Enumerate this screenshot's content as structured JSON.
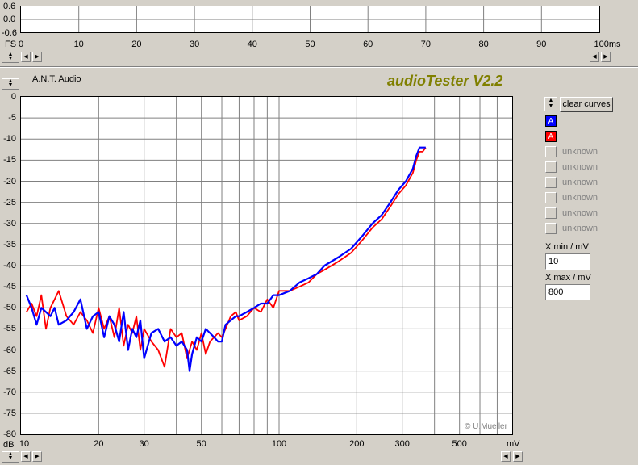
{
  "app_title": "audioTester V2.2",
  "device_name": "A.N.T. Audio",
  "scope": {
    "y_ticks": [
      "0.6",
      "0.0",
      "-0.6"
    ],
    "unit_label": "FS",
    "x_ticks": [
      "0",
      "10",
      "20",
      "30",
      "40",
      "50",
      "60",
      "70",
      "80",
      "90",
      "100ms"
    ]
  },
  "clear_curves_label": "clear curves",
  "legend": [
    {
      "letter": "A",
      "color": "#0000ff",
      "label": ""
    },
    {
      "letter": "A",
      "color": "#ff0000",
      "label": ""
    },
    {
      "letter": "",
      "color": "",
      "label": "unknown"
    },
    {
      "letter": "",
      "color": "",
      "label": "unknown"
    },
    {
      "letter": "",
      "color": "",
      "label": "unknown"
    },
    {
      "letter": "",
      "color": "",
      "label": "unknown"
    },
    {
      "letter": "",
      "color": "",
      "label": "unknown"
    },
    {
      "letter": "",
      "color": "",
      "label": "unknown"
    }
  ],
  "xmin": {
    "label": "X min / mV",
    "value": "10"
  },
  "xmax": {
    "label": "X max / mV",
    "value": "800"
  },
  "copyright": "© U.Mueller",
  "chart_data": {
    "type": "line",
    "x_scale": "log",
    "xlim": [
      10,
      800
    ],
    "ylim": [
      -80,
      0
    ],
    "grid": true,
    "xlabel": "mV",
    "ylabel": "dB",
    "x_tick_labels": [
      "10",
      "20",
      "30",
      "50",
      "100",
      "200",
      "300",
      "500"
    ],
    "y_tick_labels": [
      "0",
      "-5",
      "-10",
      "-15",
      "-20",
      "-25",
      "-30",
      "-35",
      "-40",
      "-45",
      "-50",
      "-55",
      "-60",
      "-65",
      "-70",
      "-75",
      "-80"
    ],
    "series": [
      {
        "color": "#0000ff",
        "x": [
          10.5,
          11,
          11.5,
          12,
          12.5,
          13,
          13.5,
          14,
          15,
          16,
          17,
          18,
          19,
          20,
          21,
          22,
          23,
          24,
          25,
          26,
          27,
          28,
          29,
          30,
          32,
          34,
          36,
          38,
          40,
          42,
          44,
          45,
          46,
          48,
          50,
          52,
          54,
          56,
          58,
          60,
          62,
          65,
          68,
          70,
          75,
          80,
          85,
          90,
          95,
          100,
          110,
          120,
          130,
          140,
          150,
          170,
          190,
          210,
          230,
          250,
          270,
          290,
          310,
          330,
          340,
          350,
          360,
          370
        ],
        "y": [
          -47,
          -50,
          -54,
          -50,
          -51,
          -52,
          -50,
          -54,
          -53,
          -51,
          -48,
          -55,
          -52,
          -51,
          -57,
          -52,
          -54,
          -58,
          -51,
          -60,
          -55,
          -57,
          -53,
          -62,
          -56,
          -55,
          -58,
          -57,
          -59,
          -58,
          -60,
          -65,
          -61,
          -57,
          -58,
          -55,
          -56,
          -57,
          -58,
          -58,
          -54,
          -53,
          -52,
          -52,
          -51,
          -50,
          -49,
          -49,
          -47,
          -47,
          -46,
          -44,
          -43,
          -42,
          -40,
          -38,
          -36,
          -33,
          -30,
          -28,
          -25,
          -22,
          -20,
          -17,
          -14,
          -12,
          -12,
          -12
        ]
      },
      {
        "color": "#ff0000",
        "x": [
          10.5,
          11,
          11.5,
          12,
          12.5,
          13,
          13.5,
          14,
          15,
          16,
          17,
          18,
          19,
          20,
          21,
          22,
          23,
          24,
          25,
          26,
          27,
          28,
          29,
          30,
          32,
          34,
          36,
          38,
          40,
          42,
          44,
          45,
          46,
          48,
          50,
          52,
          54,
          56,
          58,
          60,
          62,
          65,
          68,
          70,
          75,
          80,
          85,
          90,
          95,
          100,
          110,
          120,
          130,
          140,
          150,
          170,
          190,
          210,
          230,
          250,
          270,
          290,
          310,
          330,
          340,
          350,
          360,
          370
        ],
        "y": [
          -51,
          -49,
          -52,
          -47,
          -55,
          -50,
          -48,
          -46,
          -52,
          -54,
          -51,
          -53,
          -56,
          -50,
          -55,
          -52,
          -57,
          -50,
          -59,
          -54,
          -56,
          -52,
          -60,
          -55,
          -58,
          -60,
          -64,
          -55,
          -57,
          -56,
          -62,
          -60,
          -58,
          -60,
          -56,
          -61,
          -58,
          -57,
          -56,
          -57,
          -55,
          -52,
          -51,
          -53,
          -52,
          -50,
          -51,
          -48,
          -50,
          -46,
          -46,
          -45,
          -44,
          -42,
          -41,
          -39,
          -37,
          -34,
          -31,
          -29,
          -26,
          -23,
          -21,
          -18,
          -15,
          -13,
          -13,
          -12
        ]
      }
    ]
  }
}
